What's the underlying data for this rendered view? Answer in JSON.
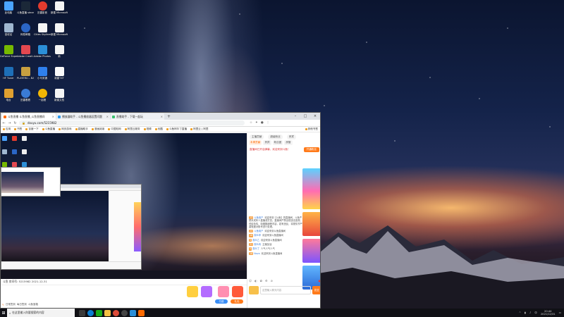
{
  "desktop_icons": [
    {
      "label": "此电脑",
      "icon": "pc-icon",
      "color": "#4aa3ff"
    },
    {
      "label": "斗鱼直播 steam",
      "icon": "steam-icon",
      "color": "#1b2838"
    },
    {
      "label": "迅雷影音",
      "icon": "media-player-icon",
      "color": "#e33b2e"
    },
    {
      "label": "新建 Microsoft...",
      "icon": "word-doc-icon",
      "color": "#f5f5f5"
    },
    {
      "label": "回收站",
      "icon": "recycle-bin-icon",
      "color": "#9fb7d0"
    },
    {
      "label": "网易邮箱",
      "icon": "mail-icon",
      "color": "#2b66c6"
    },
    {
      "label": "Cities Skylines",
      "icon": "file-icon",
      "color": "#f5f5f5"
    },
    {
      "label": "新建 Microsoft...",
      "icon": "word-doc-icon",
      "color": "#f5f5f5"
    },
    {
      "label": "GeForce Experience",
      "icon": "nvidia-icon",
      "color": "#76b900"
    },
    {
      "label": "Adobe Creati...",
      "icon": "adobe-cc-icon",
      "color": "#e34850"
    },
    {
      "label": "Adobe Photosh...",
      "icon": "photoshop-icon",
      "color": "#2b8fd8"
    },
    {
      "label": "新",
      "icon": "word-doc-icon",
      "color": "#f5f5f5"
    },
    {
      "label": "HF Tuner",
      "icon": "tuner-icon",
      "color": "#1e6fb8"
    },
    {
      "label": "PLAYERU... BATTLEGR...",
      "icon": "pubg-icon",
      "color": "#c8a040"
    },
    {
      "label": "小马宋通",
      "icon": "app-icon",
      "color": "#2f80ed"
    },
    {
      "label": "新建TXT",
      "icon": "folder-icon",
      "color": "#fafafa"
    },
    {
      "label": "电台",
      "icon": "radio-icon",
      "color": "#e0a030"
    },
    {
      "label": "迅雷看看",
      "icon": "video-app-icon",
      "color": "#3a7bd5"
    },
    {
      "label": "一起看",
      "icon": "watch-icon",
      "color": "#f2b705"
    },
    {
      "label": "新建文档",
      "icon": "doc-icon",
      "color": "#f5f5f5"
    }
  ],
  "browser": {
    "tabs": [
      {
        "title": "斗鱼直播 斗鱼直播_斗鱼直播间",
        "active": true,
        "color": "#ff6a00"
      },
      {
        "title": "播放器助手 - 斗鱼播放器设置问题",
        "active": false,
        "color": "#2e9cf0"
      },
      {
        "title": "直播助手 - 下载一起玩",
        "active": false,
        "color": "#39c06e"
      }
    ],
    "url": "douyu.com/5215982",
    "bookmarks": [
      "应用",
      "书签",
      "百度一下",
      "斗鱼直播",
      "网页游戏",
      "直播助手",
      "漫画阅读",
      "中国知网",
      "阿里云服务",
      "视频",
      "优酷",
      "斗鱼阿尔丁直播",
      "阿里云 | 阿里",
      "其他书签"
    ],
    "room_info": "斗鱼 房间号: 5215982  2021-12-31",
    "gift_bar_actions": [
      "日常签到",
      "每日签到",
      "斗鱼宝箱"
    ],
    "gift_labels": [
      "付费",
      "礼包"
    ]
  },
  "chat": {
    "header": [
      "主播贡献",
      "超级粉丝",
      "贵宾"
    ],
    "tabs": [
      "本周贡献",
      "贵宾",
      "粉丝团",
      "房管"
    ],
    "notice": "直播间已开启弹幕，欢迎来到斗鱼！",
    "notice_button": "开通粉丝",
    "messages": [
      {
        "level": "12",
        "name": "斗鱼用户",
        "text": "欢迎来到【斗鱼】的直播间，斗鱼严禁未成年人直播或打赏。直播间严禁出现违法违规、低俗色情、吸烟酗酒等内容，若有违反，将视情节严重程度对账号进行处理。"
      },
      {
        "level": "23",
        "name": "斗鱼用户",
        "text": "欢迎来到斗鱼直播间"
      },
      {
        "level": "16",
        "name": "观众甲",
        "text": "欢迎来到斗鱼直播间"
      },
      {
        "level": "9",
        "name": "观众乙",
        "text": "欢迎来到斗鱼直播间"
      },
      {
        "level": "31",
        "name": "观众丙",
        "text": "主播加油"
      },
      {
        "level": "5",
        "name": "观众丁",
        "text": "人气人气人气"
      },
      {
        "level": "18",
        "name": "Nova",
        "text": "欢迎来到斗鱼直播间"
      }
    ],
    "input_placeholder": "这里输入聊天内容",
    "send_label": "发送"
  },
  "taskbar": {
    "search_placeholder": "在这里输入你要搜索的内容",
    "apps": [
      {
        "icon": "task-view-icon",
        "color": "#3a3a3a"
      },
      {
        "icon": "edge-icon",
        "color": "#0c7fd1"
      },
      {
        "icon": "wechat-icon",
        "color": "#1aad19"
      },
      {
        "icon": "folder-icon",
        "color": "#f3c043"
      },
      {
        "icon": "chrome-icon",
        "color": "#dd4b39"
      },
      {
        "icon": "obs-icon",
        "color": "#444"
      },
      {
        "icon": "photoshop-icon",
        "color": "#2b8fd8"
      },
      {
        "icon": "douyu-icon",
        "color": "#ff6a00"
      }
    ],
    "tray": [
      "^",
      "中"
    ],
    "time": "20:44",
    "date": "2021/12/31"
  },
  "colors": {
    "accent": "#ff7a1a",
    "link": "#3b7ddd",
    "taskbar": "#101015"
  }
}
